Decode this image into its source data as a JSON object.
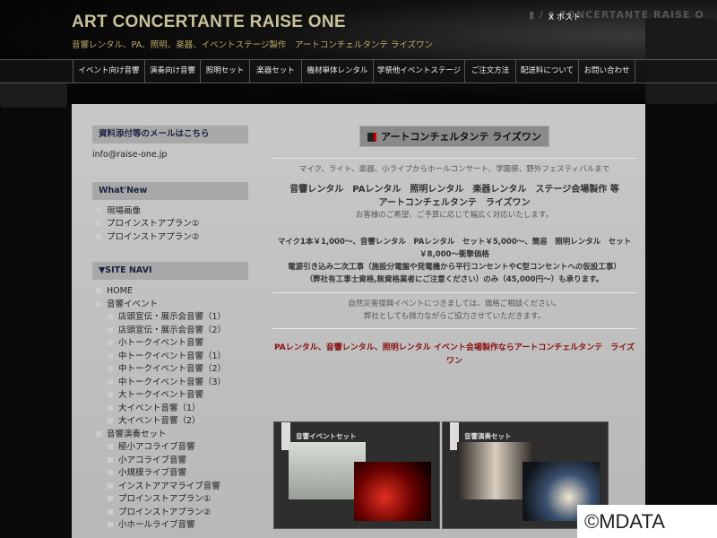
{
  "header": {
    "title": "ART CONCERTANTE RAISE ONE",
    "subtitle": "音響レンタル、PA、照明、楽器、イベントステージ製作　アートコンチェルタンテ ライズワン",
    "x_post": "X ポスト",
    "ghost_text": "▮ / ▮ CONCERTANTE RAISE O"
  },
  "nav": [
    "イベント向け音響",
    "演奏向け音響",
    "照明セット",
    "楽器セット",
    "機材単体レンタル",
    "学祭他イベントステージ",
    "ご注文方法",
    "配送料について",
    "お問い合わせ"
  ],
  "sidebar": {
    "mail_heading": "資料添付等のメールはこちら",
    "email": "info@raise-one.jp",
    "whatsnew_heading": "What'New",
    "whatsnew": [
      "現場画像",
      "プロインストアプラン①",
      "プロインストアプラン②"
    ],
    "sitenavi_heading": "▼SITE NAVI",
    "home": "HOME",
    "event_heading": "音響イベント",
    "event_items": [
      "店頭宣伝・展示会音響（1）",
      "店頭宣伝・展示会音響（2）",
      "小トークイベント音響",
      "中トークイベント音響（1）",
      "中トークイベント音響（2）",
      "中トークイベント音響（3）",
      "大トークイベント音響",
      "大イベント音響（1）",
      "大イベント音響（2）"
    ],
    "play_heading": "音響演奏セット",
    "play_items": [
      "極小アコライブ音響",
      "小アコライブ音響",
      "小規模ライブ音響",
      "インストアアマライブ音響",
      "プロインストアプラン①",
      "プロインストアプラン②",
      "小ホールライブ音響"
    ]
  },
  "main": {
    "logo": "アートコンチェルタンテ ライズワン",
    "tagline": "マイク、ライト、楽器、小ライブからホールコンサート、学園祭、野外フェスティバルまで",
    "services": "音響レンタル　PAレンタル　照明レンタル　楽器レンタル　ステージ会場製作 等",
    "company": "アートコンチェルタンテ　ライズワン",
    "service_note": "お客様のご希望、ご予算に応じて幅広く対応いたします。",
    "price1": "マイク1本￥1,000～、音響レンタル　PAレンタル　セット￥5,000～、簡易　照明レンタル　セット￥8,000～衝撃価格",
    "price2": "電源引き込み二次工事（施設分電盤や発電機から平行コンセントやC型コンセントへの仮設工事）",
    "price3": "（弊社有工事士資格,無資格業者にご注意ください）のみ（45,000円～）も承ります。",
    "disaster1": "自然災害復興イベントにつきましては、価格ご相談ください。",
    "disaster2": "弊社としても微力ながらご協力させていただきます。",
    "red_line": "PAレンタル、音響レンタル、照明レンタル イベント会場製作ならアートコンチェルタンテ　ライズワン",
    "cards": [
      "音響イベントセット",
      "音響演奏セット"
    ]
  },
  "watermark": "©MDATA"
}
